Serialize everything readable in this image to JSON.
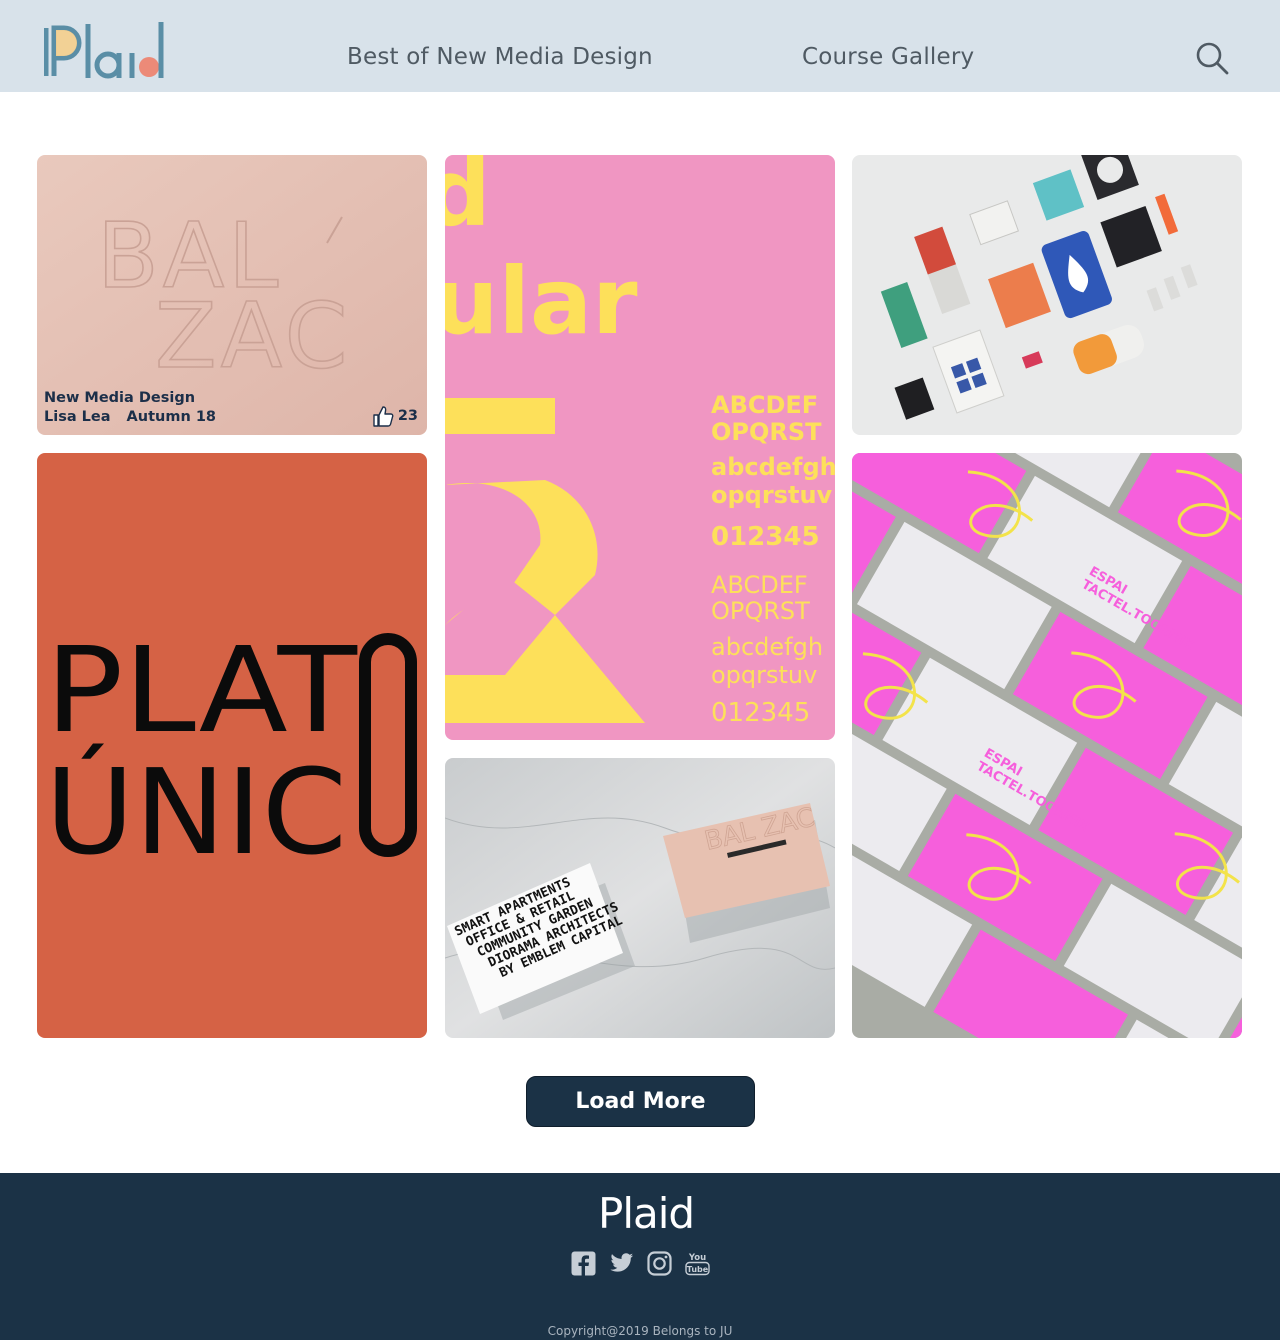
{
  "header": {
    "logo_text": "Plaid",
    "nav": {
      "best_label": "Best of New Media Design",
      "gallery_label": "Course Gallery"
    },
    "search_icon": "search-icon"
  },
  "gallery": {
    "cards": [
      {
        "id": "balzac-emboss",
        "artwork_text": [
          "BAL",
          "ZAC"
        ],
        "course": "New Media Design",
        "author": "Lisa Lea",
        "term": "Autumn 18",
        "likes": "23",
        "like_icon": "thumbs-up-icon"
      },
      {
        "id": "typeface-specimen",
        "artwork_text": [
          "d",
          "ular",
          "ABCDEF",
          "OPQRST",
          "abcdefgh",
          "opqrstuv",
          "012345"
        ]
      },
      {
        "id": "packaging-flatlay"
      },
      {
        "id": "platonico-poster",
        "artwork_text": [
          "PLAT",
          "ÚNIC",
          "O"
        ]
      },
      {
        "id": "business-cards",
        "artwork_text": [
          "SMART APARTMENTS",
          "OFFICE & RETAIL",
          "COMMUNITY GARDEN",
          "DIORAMA ARCHITECTS",
          "BY EMBLEM CAPITAL"
        ]
      },
      {
        "id": "espai-tactel-cards",
        "artwork_text": [
          "ESPAI",
          "TACTEL.TOORMIX"
        ]
      }
    ]
  },
  "load_more": {
    "label": "Load More"
  },
  "footer": {
    "logo_text": "Plaid",
    "socials": [
      "facebook-icon",
      "twitter-icon",
      "instagram-icon",
      "youtube-icon"
    ],
    "youtube_text": [
      "You",
      "Tube"
    ],
    "copyright": "Copyright@2019 Belongs to JU"
  },
  "colors": {
    "header_bg": "#d8e2ea",
    "footer_bg": "#1b3246",
    "accent_navy": "#1c2f49",
    "logo_blue": "#5a8ea6",
    "logo_yellow": "#f5cf8c",
    "logo_coral": "#ec8a78"
  }
}
